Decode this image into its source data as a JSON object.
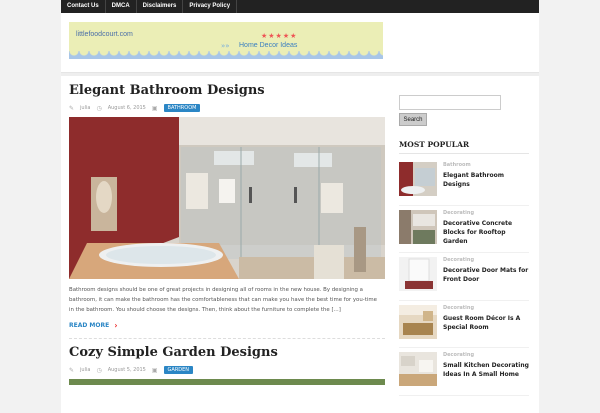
{
  "topnav": {
    "items": [
      "Contact Us",
      "DMCA",
      "Disclaimers",
      "Privacy Policy"
    ]
  },
  "header": {
    "site_name": "littlefoodcourt.com",
    "stars": "★★★★★",
    "tagline": "Home Decor Ideas",
    "arrows": "»»"
  },
  "posts": [
    {
      "title": "Elegant Bathroom Designs",
      "author": "julia",
      "date": "August 6, 2015",
      "category": "BATHROOM",
      "excerpt": "Bathroom designs should be one of great projects in designing all of rooms in the new house. By designing a bathroom, it can make the bathroom has the comfortableness that can make you have the best time for you-time in the bathroom. You should choose the designs. Then, think about the furniture to complete the [...]",
      "read_more": "READ MORE"
    },
    {
      "title": "Cozy Simple Garden Designs",
      "author": "julia",
      "date": "August 5, 2015",
      "category": "GARDEN"
    }
  ],
  "sidebar": {
    "search_button": "Search",
    "popular_title": "MOST POPULAR",
    "popular": [
      {
        "category": "Bathroom",
        "title": "Elegant Bathroom Designs"
      },
      {
        "category": "Decorating",
        "title": "Decorative Concrete Blocks for Rooftop Garden"
      },
      {
        "category": "Decorating",
        "title": "Decorative Door Mats for Front Door"
      },
      {
        "category": "Decorating",
        "title": "Guest Room Décor Is A Special Room"
      },
      {
        "category": "Decorating",
        "title": "Small Kitchen Decorating Ideas In A Small Home"
      }
    ]
  },
  "colors": {
    "accent": "#2b86c5",
    "topbar": "#222222",
    "chevron": "#e33333"
  }
}
